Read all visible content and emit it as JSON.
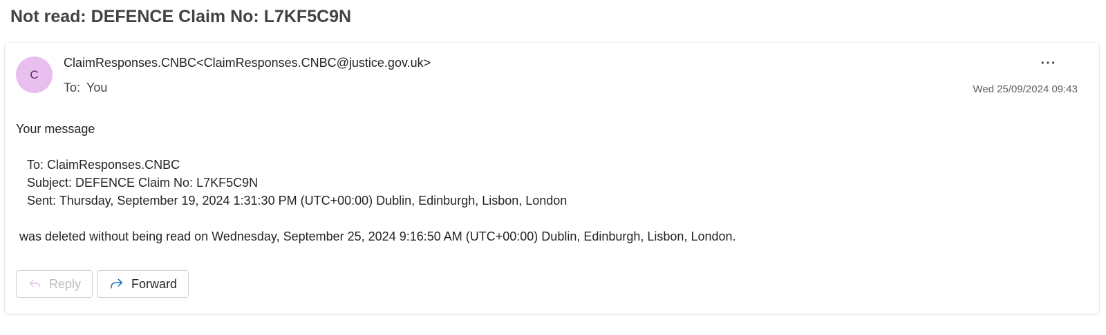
{
  "message": {
    "subject": "Not read: DEFENCE Claim No: L7KF5C9N",
    "avatar_initial": "C",
    "avatar_color": "#e8bfee",
    "sender_name": "ClaimResponses.CNBC",
    "sender_email": "<ClaimResponses.CNBC@justice.gov.uk>",
    "to_label": "To:",
    "to_value": "You",
    "more_label": "···",
    "datetime": "Wed 25/09/2024 09:43"
  },
  "body": {
    "intro": "Your message",
    "quoted_to": "To: ClaimResponses.CNBC",
    "quoted_subject": "Subject: DEFENCE Claim No: L7KF5C9N",
    "quoted_sent": "Sent: Thursday, September 19, 2024 1:31:30 PM (UTC+00:00) Dublin, Edinburgh, Lisbon, London",
    "final": "was deleted without being read on Wednesday, September 25, 2024 9:16:50 AM (UTC+00:00) Dublin, Edinburgh, Lisbon, London."
  },
  "actions": {
    "reply_label": "Reply",
    "reply_icon": "reply-arrow-icon",
    "forward_label": "Forward",
    "forward_icon": "forward-arrow-icon",
    "reply_disabled": true
  },
  "colors": {
    "accent_icon": "#0f6cbd",
    "disabled_icon": "#e8bfee"
  }
}
